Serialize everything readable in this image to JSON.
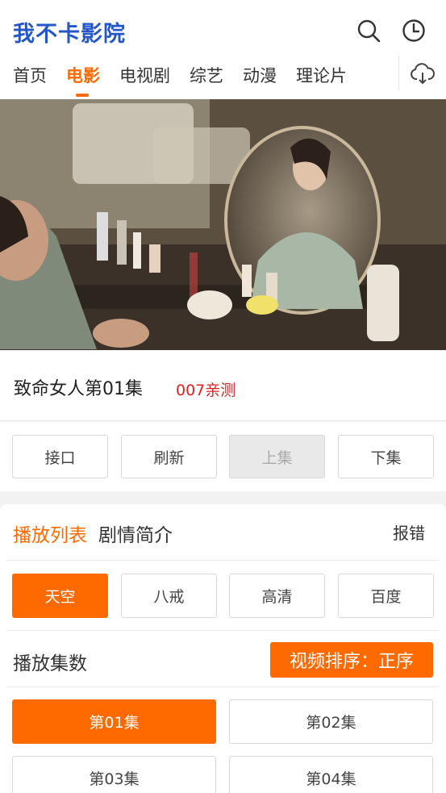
{
  "app": {
    "logo_text": "我不卡影院"
  },
  "header_icons": [
    "search-icon",
    "history-clock-icon",
    "download-cloud-icon"
  ],
  "nav": {
    "items": [
      {
        "label": "首页",
        "active": false
      },
      {
        "label": "电影",
        "active": true
      },
      {
        "label": "电视剧",
        "active": false
      },
      {
        "label": "综艺",
        "active": false
      },
      {
        "label": "动漫",
        "active": false
      },
      {
        "label": "理论片",
        "active": false
      }
    ]
  },
  "video": {
    "title": "致命女人第01集",
    "source_tag": "007亲测"
  },
  "controls": {
    "interface": "接口",
    "refresh": "刷新",
    "prev": "上集",
    "next": "下集"
  },
  "panel": {
    "tab_playlist": "播放列表",
    "tab_synopsis": "剧情简介",
    "report": "报错",
    "sources": [
      {
        "label": "天空",
        "active": true
      },
      {
        "label": "八戒",
        "active": false
      },
      {
        "label": "高清",
        "active": false
      },
      {
        "label": "百度",
        "active": false
      }
    ],
    "episode_count_label": "播放集数",
    "sort_label": "视频排序：正序",
    "episodes": [
      {
        "label": "第01集",
        "active": true
      },
      {
        "label": "第02集",
        "active": false
      },
      {
        "label": "第03集",
        "active": false
      },
      {
        "label": "第04集",
        "active": false
      }
    ]
  },
  "colors": {
    "accent": "#ff6a00",
    "logo": "#2456c7",
    "tag": "#e02020"
  }
}
